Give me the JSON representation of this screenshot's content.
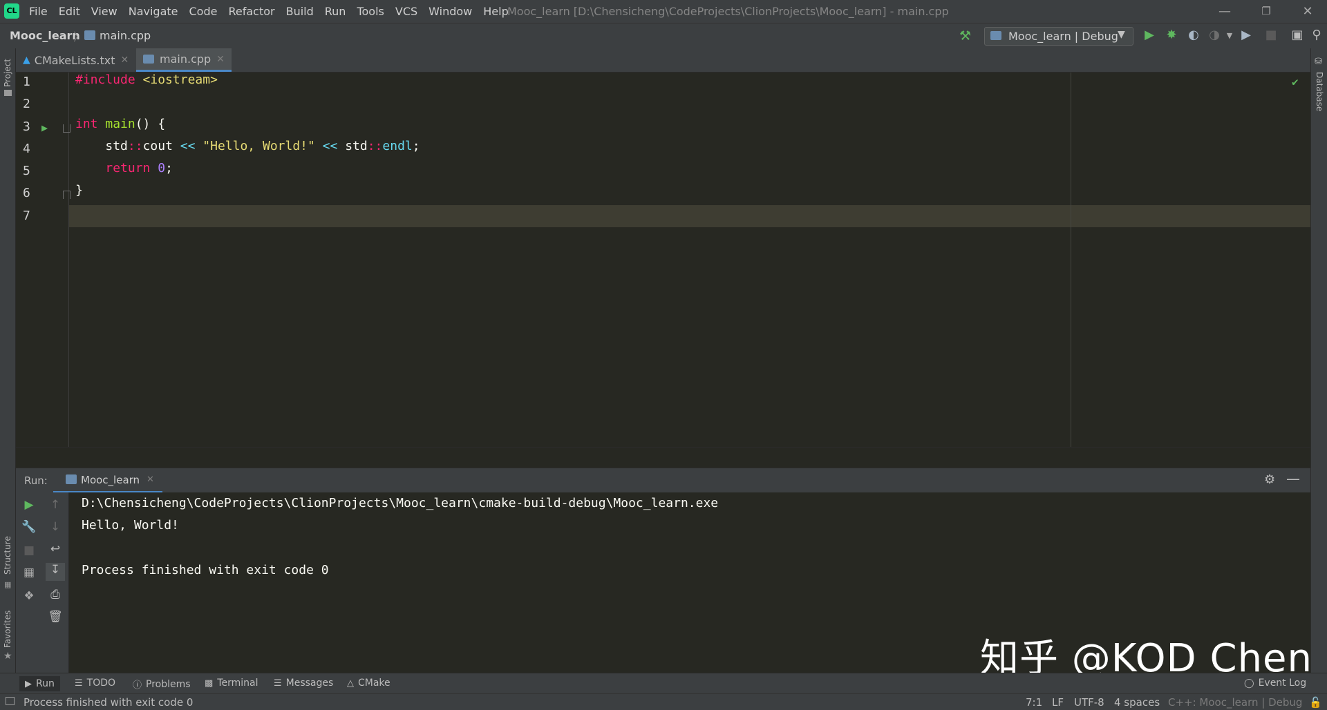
{
  "app": {
    "logo_text": "CL",
    "window_title": "Mooc_learn [D:\\Chensicheng\\CodeProjects\\ClionProjects\\Mooc_learn] - main.cpp"
  },
  "menu": [
    "File",
    "Edit",
    "View",
    "Navigate",
    "Code",
    "Refactor",
    "Build",
    "Run",
    "Tools",
    "VCS",
    "Window",
    "Help"
  ],
  "breadcrumb": {
    "project": "Mooc_learn",
    "file": "main.cpp"
  },
  "run_config": {
    "label": "Mooc_learn | Debug"
  },
  "tool_windows": {
    "left_top": "Project",
    "left_mid": "Structure",
    "left_bottom": "Favorites",
    "right": "Database"
  },
  "tabs": [
    {
      "label": "CMakeLists.txt",
      "active": false
    },
    {
      "label": "main.cpp",
      "active": true
    }
  ],
  "editor": {
    "line_numbers": [
      "1",
      "2",
      "3",
      "4",
      "5",
      "6",
      "7"
    ],
    "tokens": {
      "l1_pp": "#include",
      "l1_inc": "<iostream>",
      "l3_kw": "int",
      "l3_fn": "main",
      "l3_rest": "() {",
      "l4_std1": "std",
      "l4_sep1": "::",
      "l4_cout": "cout",
      "l4_op1": " << ",
      "l4_str": "\"Hello, World!\"",
      "l4_op2": " << ",
      "l4_std2": "std",
      "l4_sep2": "::",
      "l4_endl": "endl",
      "l4_semi": ";",
      "l5_kw": "return",
      "l5_num": "0",
      "l5_semi": ";",
      "l6": "}"
    }
  },
  "run_panel": {
    "label": "Run:",
    "tab": "Mooc_learn",
    "console": [
      "D:\\Chensicheng\\CodeProjects\\ClionProjects\\Mooc_learn\\cmake-build-debug\\Mooc_learn.exe",
      "Hello, World!",
      "",
      "Process finished with exit code 0"
    ]
  },
  "watermark": "知乎 @KOD Chen",
  "bottom_tools": [
    "Run",
    "TODO",
    "Problems",
    "Terminal",
    "Messages",
    "CMake",
    "Event Log"
  ],
  "status": {
    "message": "Process finished with exit code 0",
    "position": "7:1",
    "line_sep": "LF",
    "encoding": "UTF-8",
    "indent": "4 spaces",
    "context": "C++: Mooc_learn | Debug"
  },
  "colors": {
    "accent": "#4a88c7",
    "run_green": "#5fb85f",
    "keyword": "#f92672",
    "function": "#a6e22e",
    "string": "#e6db74",
    "number": "#ae81ff",
    "namespace": "#66d9ef"
  }
}
